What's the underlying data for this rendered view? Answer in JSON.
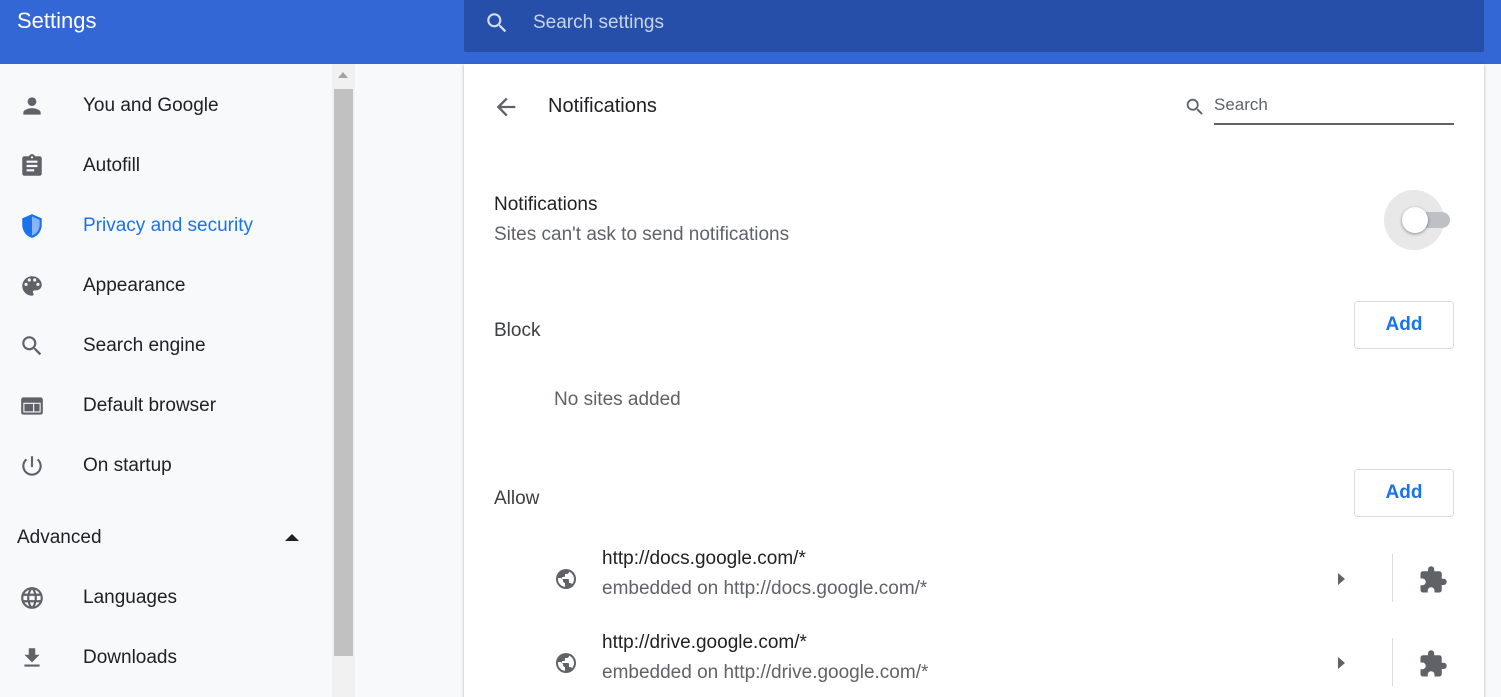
{
  "header": {
    "title": "Settings",
    "search_placeholder": "Search settings"
  },
  "sidebar": {
    "items": [
      {
        "label": "You and Google",
        "icon": "person-icon"
      },
      {
        "label": "Autofill",
        "icon": "clipboard-icon"
      },
      {
        "label": "Privacy and security",
        "icon": "shield-icon",
        "active": true
      },
      {
        "label": "Appearance",
        "icon": "palette-icon"
      },
      {
        "label": "Search engine",
        "icon": "search-icon"
      },
      {
        "label": "Default browser",
        "icon": "browser-window-icon"
      },
      {
        "label": "On startup",
        "icon": "power-icon"
      }
    ],
    "advanced_label": "Advanced",
    "advanced_items": [
      {
        "label": "Languages",
        "icon": "globe-icon"
      },
      {
        "label": "Downloads",
        "icon": "download-icon"
      }
    ]
  },
  "main": {
    "title": "Notifications",
    "search_placeholder": "Search",
    "toggle": {
      "title": "Notifications",
      "subtitle": "Sites can't ask to send notifications",
      "enabled": false
    },
    "block": {
      "label": "Block",
      "add_label": "Add",
      "empty_text": "No sites added"
    },
    "allow": {
      "label": "Allow",
      "add_label": "Add",
      "sites": [
        {
          "url": "http://docs.google.com/*",
          "embedded": "embedded on http://docs.google.com/*"
        },
        {
          "url": "http://drive.google.com/*",
          "embedded": "embedded on http://drive.google.com/*"
        }
      ]
    }
  },
  "colors": {
    "header_bg": "#3367d6",
    "search_bg": "#254fa8",
    "accent": "#1a73e8"
  }
}
